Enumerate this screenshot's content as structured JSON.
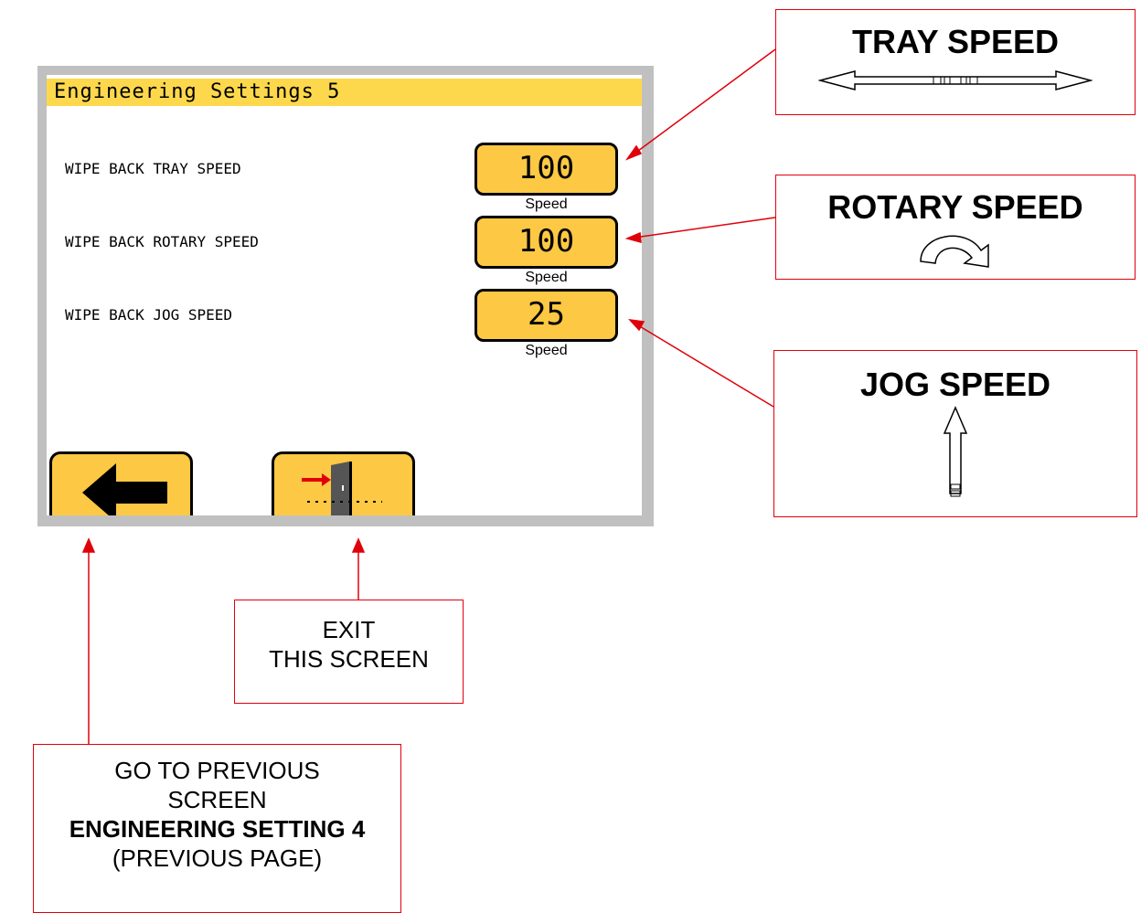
{
  "screen": {
    "title": "Engineering Settings 5",
    "rows": [
      {
        "label": "WIPE BACK TRAY SPEED",
        "value": "100",
        "unit": "Speed"
      },
      {
        "label": "WIPE BACK ROTARY SPEED",
        "value": "100",
        "unit": "Speed"
      },
      {
        "label": "WIPE BACK JOG SPEED",
        "value": "25",
        "unit": "Speed"
      }
    ],
    "buttons": {
      "back_icon": "left-arrow-icon",
      "exit_icon": "exit-door-icon"
    },
    "colors": {
      "title_bar": "#fdd84c",
      "button": "#fdc843",
      "frame": "#c0c0c0"
    }
  },
  "callouts": {
    "tray_speed": "TRAY SPEED",
    "rotary_speed": "ROTARY SPEED",
    "jog_speed": "JOG SPEED",
    "exit_line1": "EXIT",
    "exit_line2": "THIS SCREEN",
    "prev_line1": "GO TO PREVIOUS",
    "prev_line2": "SCREEN",
    "prev_line3": "ENGINEERING SETTING 4",
    "prev_line4": "(PREVIOUS PAGE)",
    "color": "#e0000a"
  }
}
